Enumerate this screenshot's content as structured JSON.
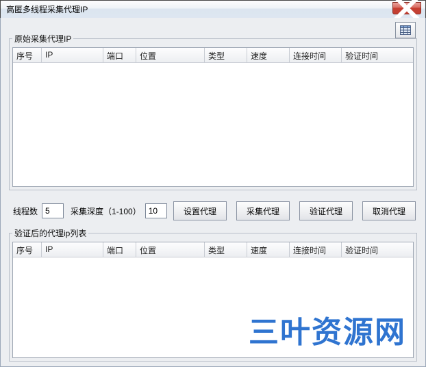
{
  "window": {
    "title": "高匿多线程采集代理IP"
  },
  "group_top": {
    "legend": "原始采集代理IP",
    "columns": [
      "序号",
      "IP",
      "端口",
      "位置",
      "类型",
      "速度",
      "连接时间",
      "验证时间"
    ],
    "rows": []
  },
  "controls": {
    "threads_label": "线程数",
    "threads_value": "5",
    "depth_label": "采集深度（1-100）",
    "depth_value": "10",
    "btn_set": "设置代理",
    "btn_collect": "采集代理",
    "btn_verify": "验证代理",
    "btn_cancel": "取消代理"
  },
  "group_bot": {
    "legend": "验证后的代理ip列表",
    "columns": [
      "序号",
      "IP",
      "端口",
      "位置",
      "类型",
      "速度",
      "连接时间",
      "验证时间"
    ],
    "rows": []
  },
  "watermark": "三叶资源网"
}
